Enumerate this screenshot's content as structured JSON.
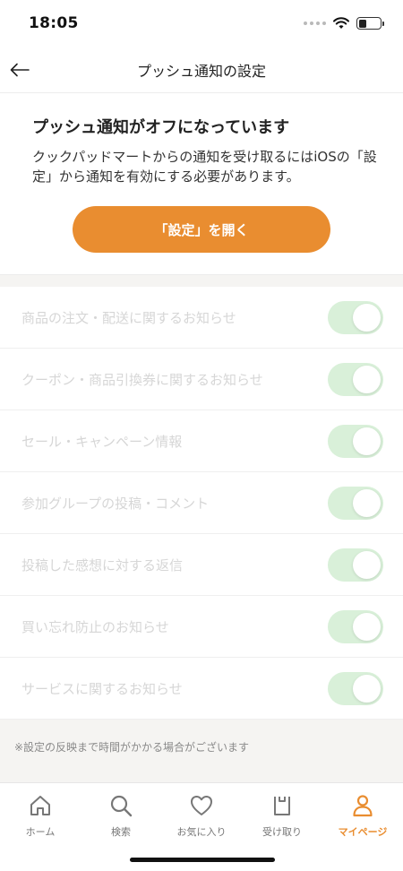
{
  "status_bar": {
    "time": "18:05"
  },
  "nav": {
    "title": "プッシュ通知の設定"
  },
  "alert": {
    "title": "プッシュ通知がオフになっています",
    "body": "クックパッドマートからの通知を受け取るにはiOSの「設定」から通知を有効にする必要があります。",
    "button_label": "「設定」を開く"
  },
  "settings": {
    "items": [
      {
        "label": "商品の注文・配送に関するお知らせ",
        "enabled": true
      },
      {
        "label": "クーポン・商品引換券に関するお知らせ",
        "enabled": true
      },
      {
        "label": "セール・キャンペーン情報",
        "enabled": true
      },
      {
        "label": "参加グループの投稿・コメント",
        "enabled": true
      },
      {
        "label": "投稿した感想に対する返信",
        "enabled": true
      },
      {
        "label": "買い忘れ防止のお知らせ",
        "enabled": true
      },
      {
        "label": "サービスに関するお知らせ",
        "enabled": true
      }
    ]
  },
  "footer": {
    "note": "※設定の反映まで時間がかかる場合がございます"
  },
  "tab_bar": {
    "tabs": [
      {
        "label": "ホーム",
        "icon": "home-icon"
      },
      {
        "label": "検索",
        "icon": "search-icon"
      },
      {
        "label": "お気に入り",
        "icon": "heart-icon"
      },
      {
        "label": "受け取り",
        "icon": "bag-icon"
      },
      {
        "label": "マイページ",
        "icon": "person-icon"
      }
    ],
    "active_index": 4
  },
  "colors": {
    "accent": "#e98d30",
    "toggle_on_disabled": "#d9f0d9",
    "disabled_text": "#d6d6d6",
    "section_bg": "#f5f4f2"
  }
}
